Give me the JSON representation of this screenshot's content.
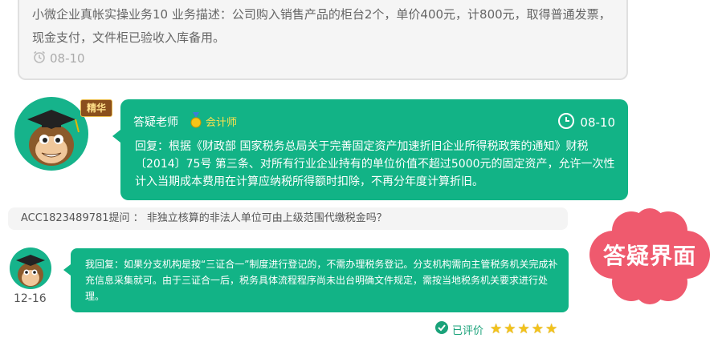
{
  "question": {
    "text": "小微企业真帐实操业务10 业务描述：公司购入销售产品的柜台2个，单价400元，计800元，取得普通发票，现金支付，文件柜已验收入库备用。",
    "date": "08-10"
  },
  "answer": {
    "badge": "精华",
    "teacher_name": "答疑老师",
    "teacher_title": "会计师",
    "date": "08-10",
    "text": "回复：根据《财政部 国家税务总局关于完善固定资产加速折旧企业所得税政策的通知》财税〔2014〕75号 第三条、对所有行业企业持有的单位价值不超过5000元的固定资产，允许一次性计入当期成本费用在计算应纳税所得额时扣除，不再分年度计算折旧。"
  },
  "followup": {
    "question": "ACC1823489781提问 ： 非独立核算的非法人单位可由上级范围代缴税金吗？",
    "reply": "我回复：如果分支机构是按“三证合一”制度进行登记的，不需办理税务登记。分支机构需向主管税务机关完成补充信息采集就可。由于三证合一后，税务具体流程程序尚未出台明确文件规定，需按当地税务机关要求进行处理。",
    "date": "12-16",
    "rated_label": "已评价",
    "stars": 5
  },
  "watermark": "答疑界面",
  "colors": {
    "accent": "#12b386",
    "flower": "#ef5a6e",
    "star": "#f2c21b"
  }
}
